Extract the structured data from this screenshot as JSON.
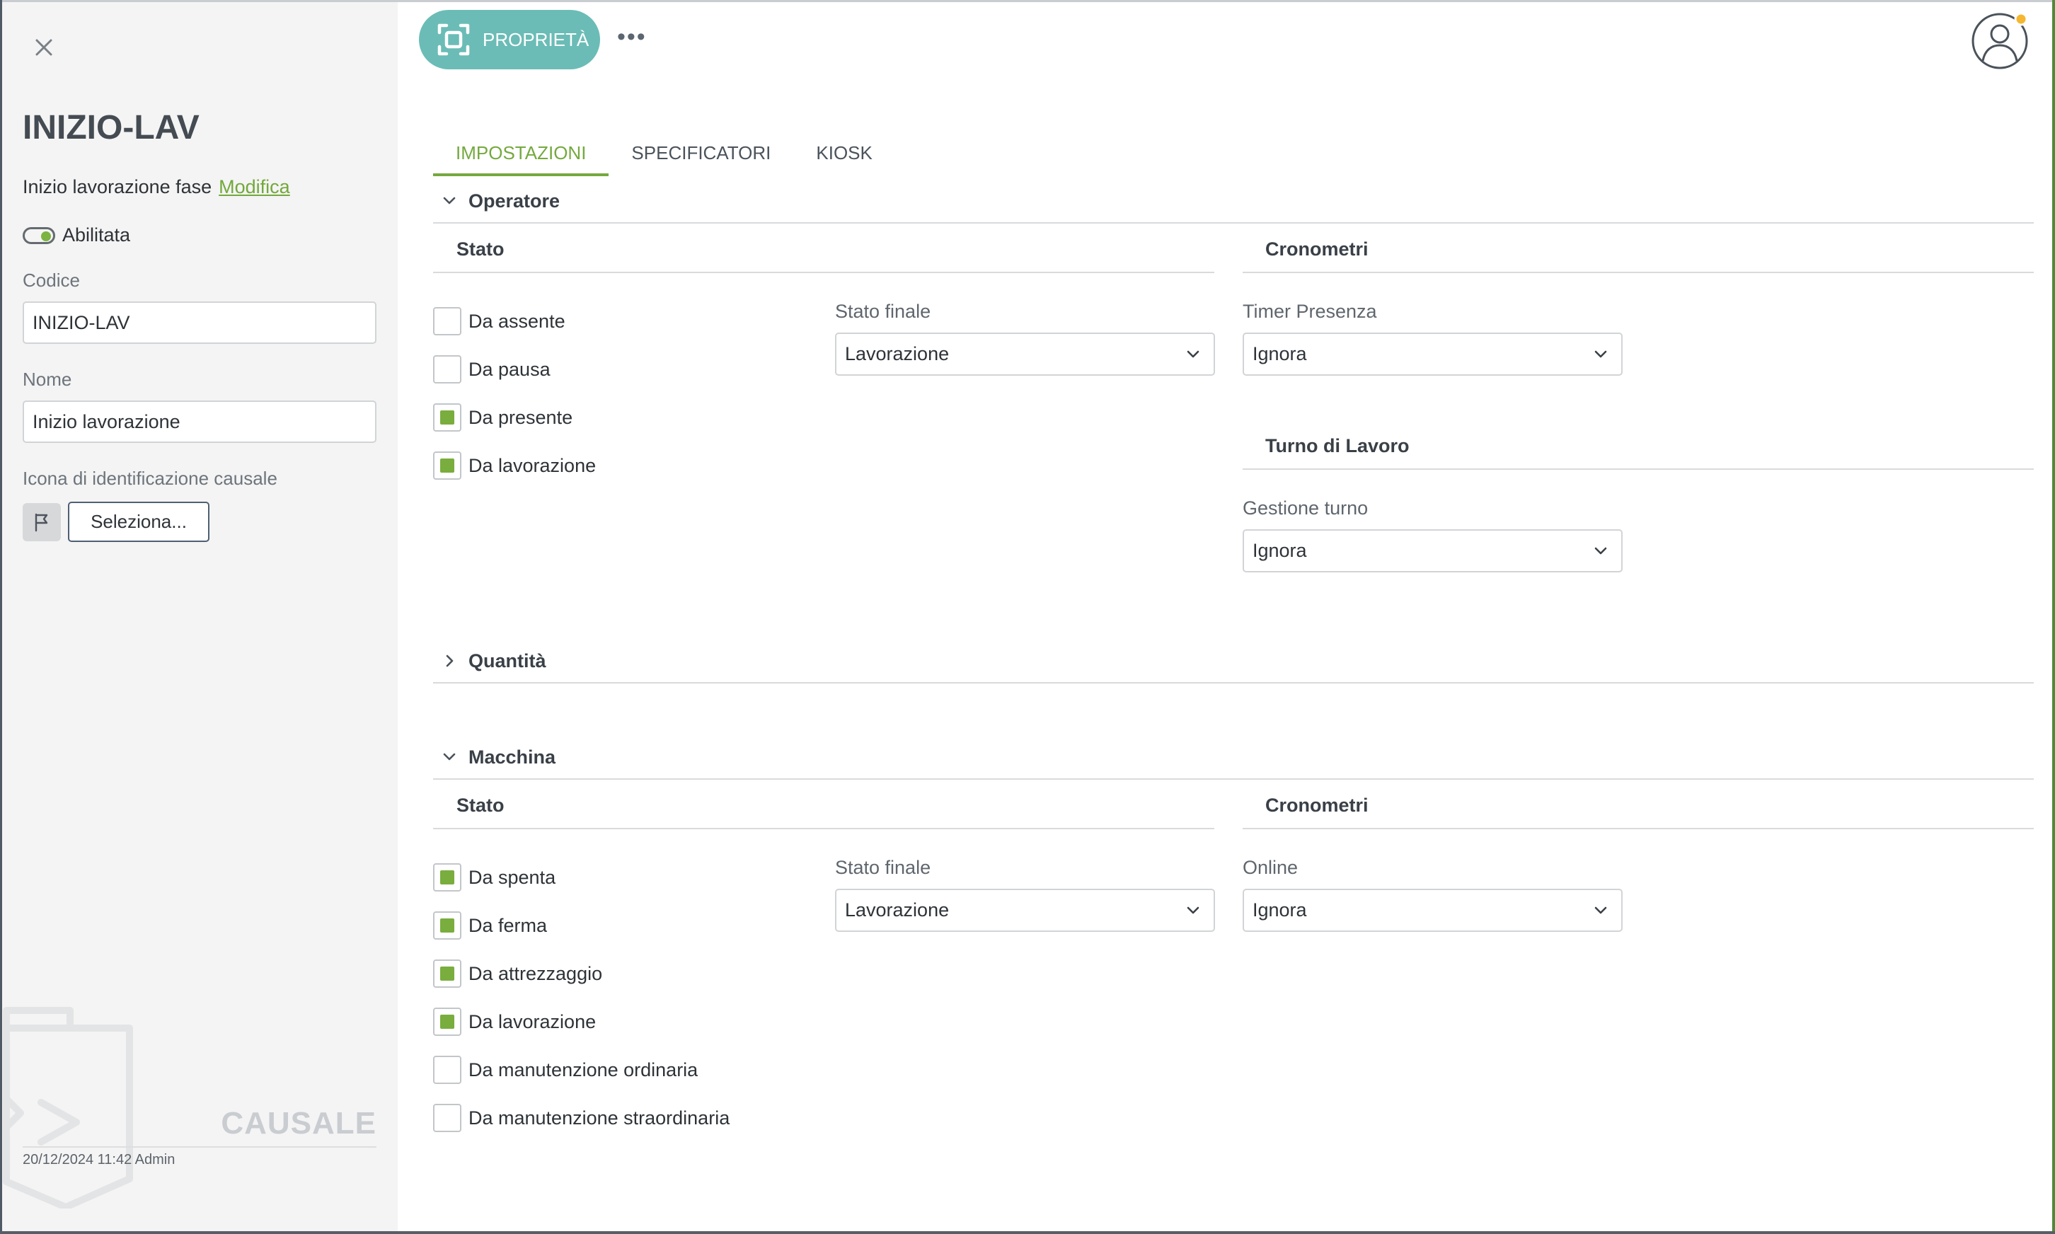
{
  "sidebar": {
    "title": "INIZIO-LAV",
    "description": "Inizio lavorazione fase",
    "edit_link": "Modifica",
    "enabled_label": "Abilitata",
    "code_label": "Codice",
    "code_value": "INIZIO-LAV",
    "name_label": "Nome",
    "name_value": "Inizio lavorazione",
    "icon_label": "Icona di identificazione causale",
    "select_button": "Seleziona...",
    "entity_type": "CAUSALE",
    "footer": "20/12/2024 11:42 Admin",
    "icons": {
      "close": "close-icon",
      "flag": "flag-icon",
      "watermark": "clipboard-icon"
    }
  },
  "header": {
    "properties_button": "PROPRIETÀ",
    "more_button": "•••",
    "icons": {
      "properties": "focus-frame-icon",
      "avatar": "user-avatar-icon"
    },
    "accent_color": "#6bbcb6"
  },
  "tabs": [
    {
      "label": "IMPOSTAZIONI",
      "active": true
    },
    {
      "label": "SPECIFICATORI",
      "active": false
    },
    {
      "label": "KIOSK",
      "active": false
    }
  ],
  "operatore": {
    "title": "Operatore",
    "expanded": true,
    "state_title": "Stato",
    "checkboxes": [
      {
        "label": "Da assente",
        "checked": false
      },
      {
        "label": "Da pausa",
        "checked": false
      },
      {
        "label": "Da presente",
        "checked": true
      },
      {
        "label": "Da lavorazione",
        "checked": true
      }
    ],
    "final_state_label": "Stato finale",
    "final_state_value": "Lavorazione",
    "timers_title": "Cronometri",
    "timer_presence_label": "Timer Presenza",
    "timer_presence_value": "Ignora",
    "shift_title": "Turno di Lavoro",
    "shift_management_label": "Gestione turno",
    "shift_management_value": "Ignora"
  },
  "quantita": {
    "title": "Quantità",
    "expanded": false
  },
  "macchina": {
    "title": "Macchina",
    "expanded": true,
    "state_title": "Stato",
    "checkboxes": [
      {
        "label": "Da spenta",
        "checked": true
      },
      {
        "label": "Da ferma",
        "checked": true
      },
      {
        "label": "Da attrezzaggio",
        "checked": true
      },
      {
        "label": "Da lavorazione",
        "checked": true
      },
      {
        "label": "Da manutenzione ordinaria",
        "checked": false
      },
      {
        "label": "Da manutenzione straordinaria",
        "checked": false
      }
    ],
    "final_state_label": "Stato finale",
    "final_state_value": "Lavorazione",
    "timers_title": "Cronometri",
    "online_label": "Online",
    "online_value": "Ignora"
  },
  "colors": {
    "accent_green": "#75a93f",
    "teal": "#6bbcb6",
    "notification": "#f5b731"
  }
}
